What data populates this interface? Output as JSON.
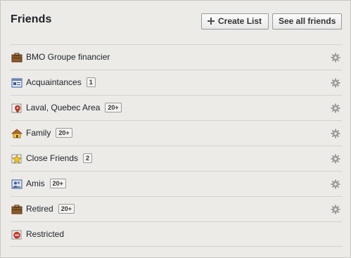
{
  "header": {
    "title": "Friends",
    "create_list_label": "Create List",
    "see_all_label": "See all friends"
  },
  "lists": [
    {
      "label": "BMO Groupe financier",
      "count": "",
      "icon": "briefcase-icon"
    },
    {
      "label": "Acquaintances",
      "count": "1",
      "icon": "acquaintances-icon"
    },
    {
      "label": "Laval, Quebec Area",
      "count": "20+",
      "icon": "location-pin-icon"
    },
    {
      "label": "Family",
      "count": "20+",
      "icon": "house-icon"
    },
    {
      "label": "Close Friends",
      "count": "2",
      "icon": "star-icon"
    },
    {
      "label": "Amis",
      "count": "20+",
      "icon": "people-icon"
    },
    {
      "label": "Retired",
      "count": "20+",
      "icon": "briefcase-icon"
    },
    {
      "label": "Restricted",
      "count": "",
      "icon": "restricted-icon"
    }
  ],
  "colors": {
    "background": "#ecebe8",
    "divider": "#d3d1cc",
    "text": "#1d2129",
    "gear": "#9c9c9c"
  }
}
